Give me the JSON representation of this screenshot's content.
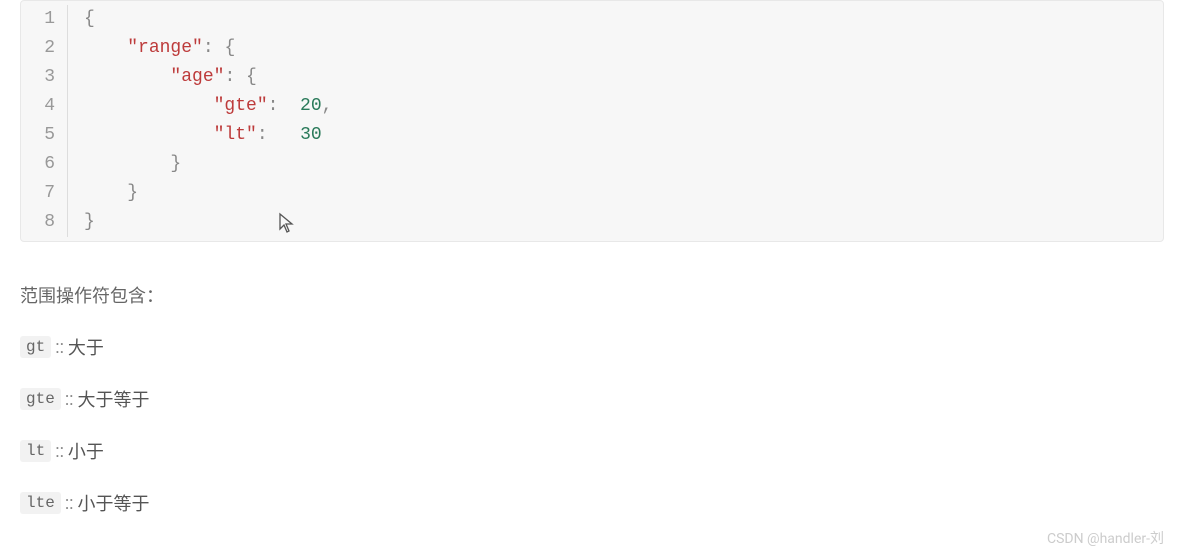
{
  "code": {
    "lineNumbers": [
      "1",
      "2",
      "3",
      "4",
      "5",
      "6",
      "7",
      "8"
    ],
    "lines": [
      {
        "indent": "",
        "tokens": [
          {
            "t": "punct",
            "v": "{"
          }
        ]
      },
      {
        "indent": "    ",
        "tokens": [
          {
            "t": "key",
            "v": "\"range\""
          },
          {
            "t": "punct",
            "v": ": {"
          }
        ]
      },
      {
        "indent": "        ",
        "tokens": [
          {
            "t": "key",
            "v": "\"age\""
          },
          {
            "t": "punct",
            "v": ": {"
          }
        ]
      },
      {
        "indent": "            ",
        "tokens": [
          {
            "t": "key",
            "v": "\"gte\""
          },
          {
            "t": "punct",
            "v": ":  "
          },
          {
            "t": "number",
            "v": "20"
          },
          {
            "t": "punct",
            "v": ","
          }
        ]
      },
      {
        "indent": "            ",
        "tokens": [
          {
            "t": "key",
            "v": "\"lt\""
          },
          {
            "t": "punct",
            "v": ":   "
          },
          {
            "t": "number",
            "v": "30"
          }
        ]
      },
      {
        "indent": "        ",
        "tokens": [
          {
            "t": "punct",
            "v": "}"
          }
        ]
      },
      {
        "indent": "    ",
        "tokens": [
          {
            "t": "punct",
            "v": "}"
          }
        ]
      },
      {
        "indent": "",
        "tokens": [
          {
            "t": "punct",
            "v": "}"
          }
        ]
      }
    ]
  },
  "description": {
    "intro": "范围操作符包含：",
    "operators": [
      {
        "code": "gt",
        "desc": "大于"
      },
      {
        "code": "gte",
        "desc": "大于等于"
      },
      {
        "code": "lt",
        "desc": "小于"
      },
      {
        "code": "lte",
        "desc": "小于等于"
      }
    ],
    "separator": "::"
  },
  "watermark": "CSDN @handler-刘"
}
